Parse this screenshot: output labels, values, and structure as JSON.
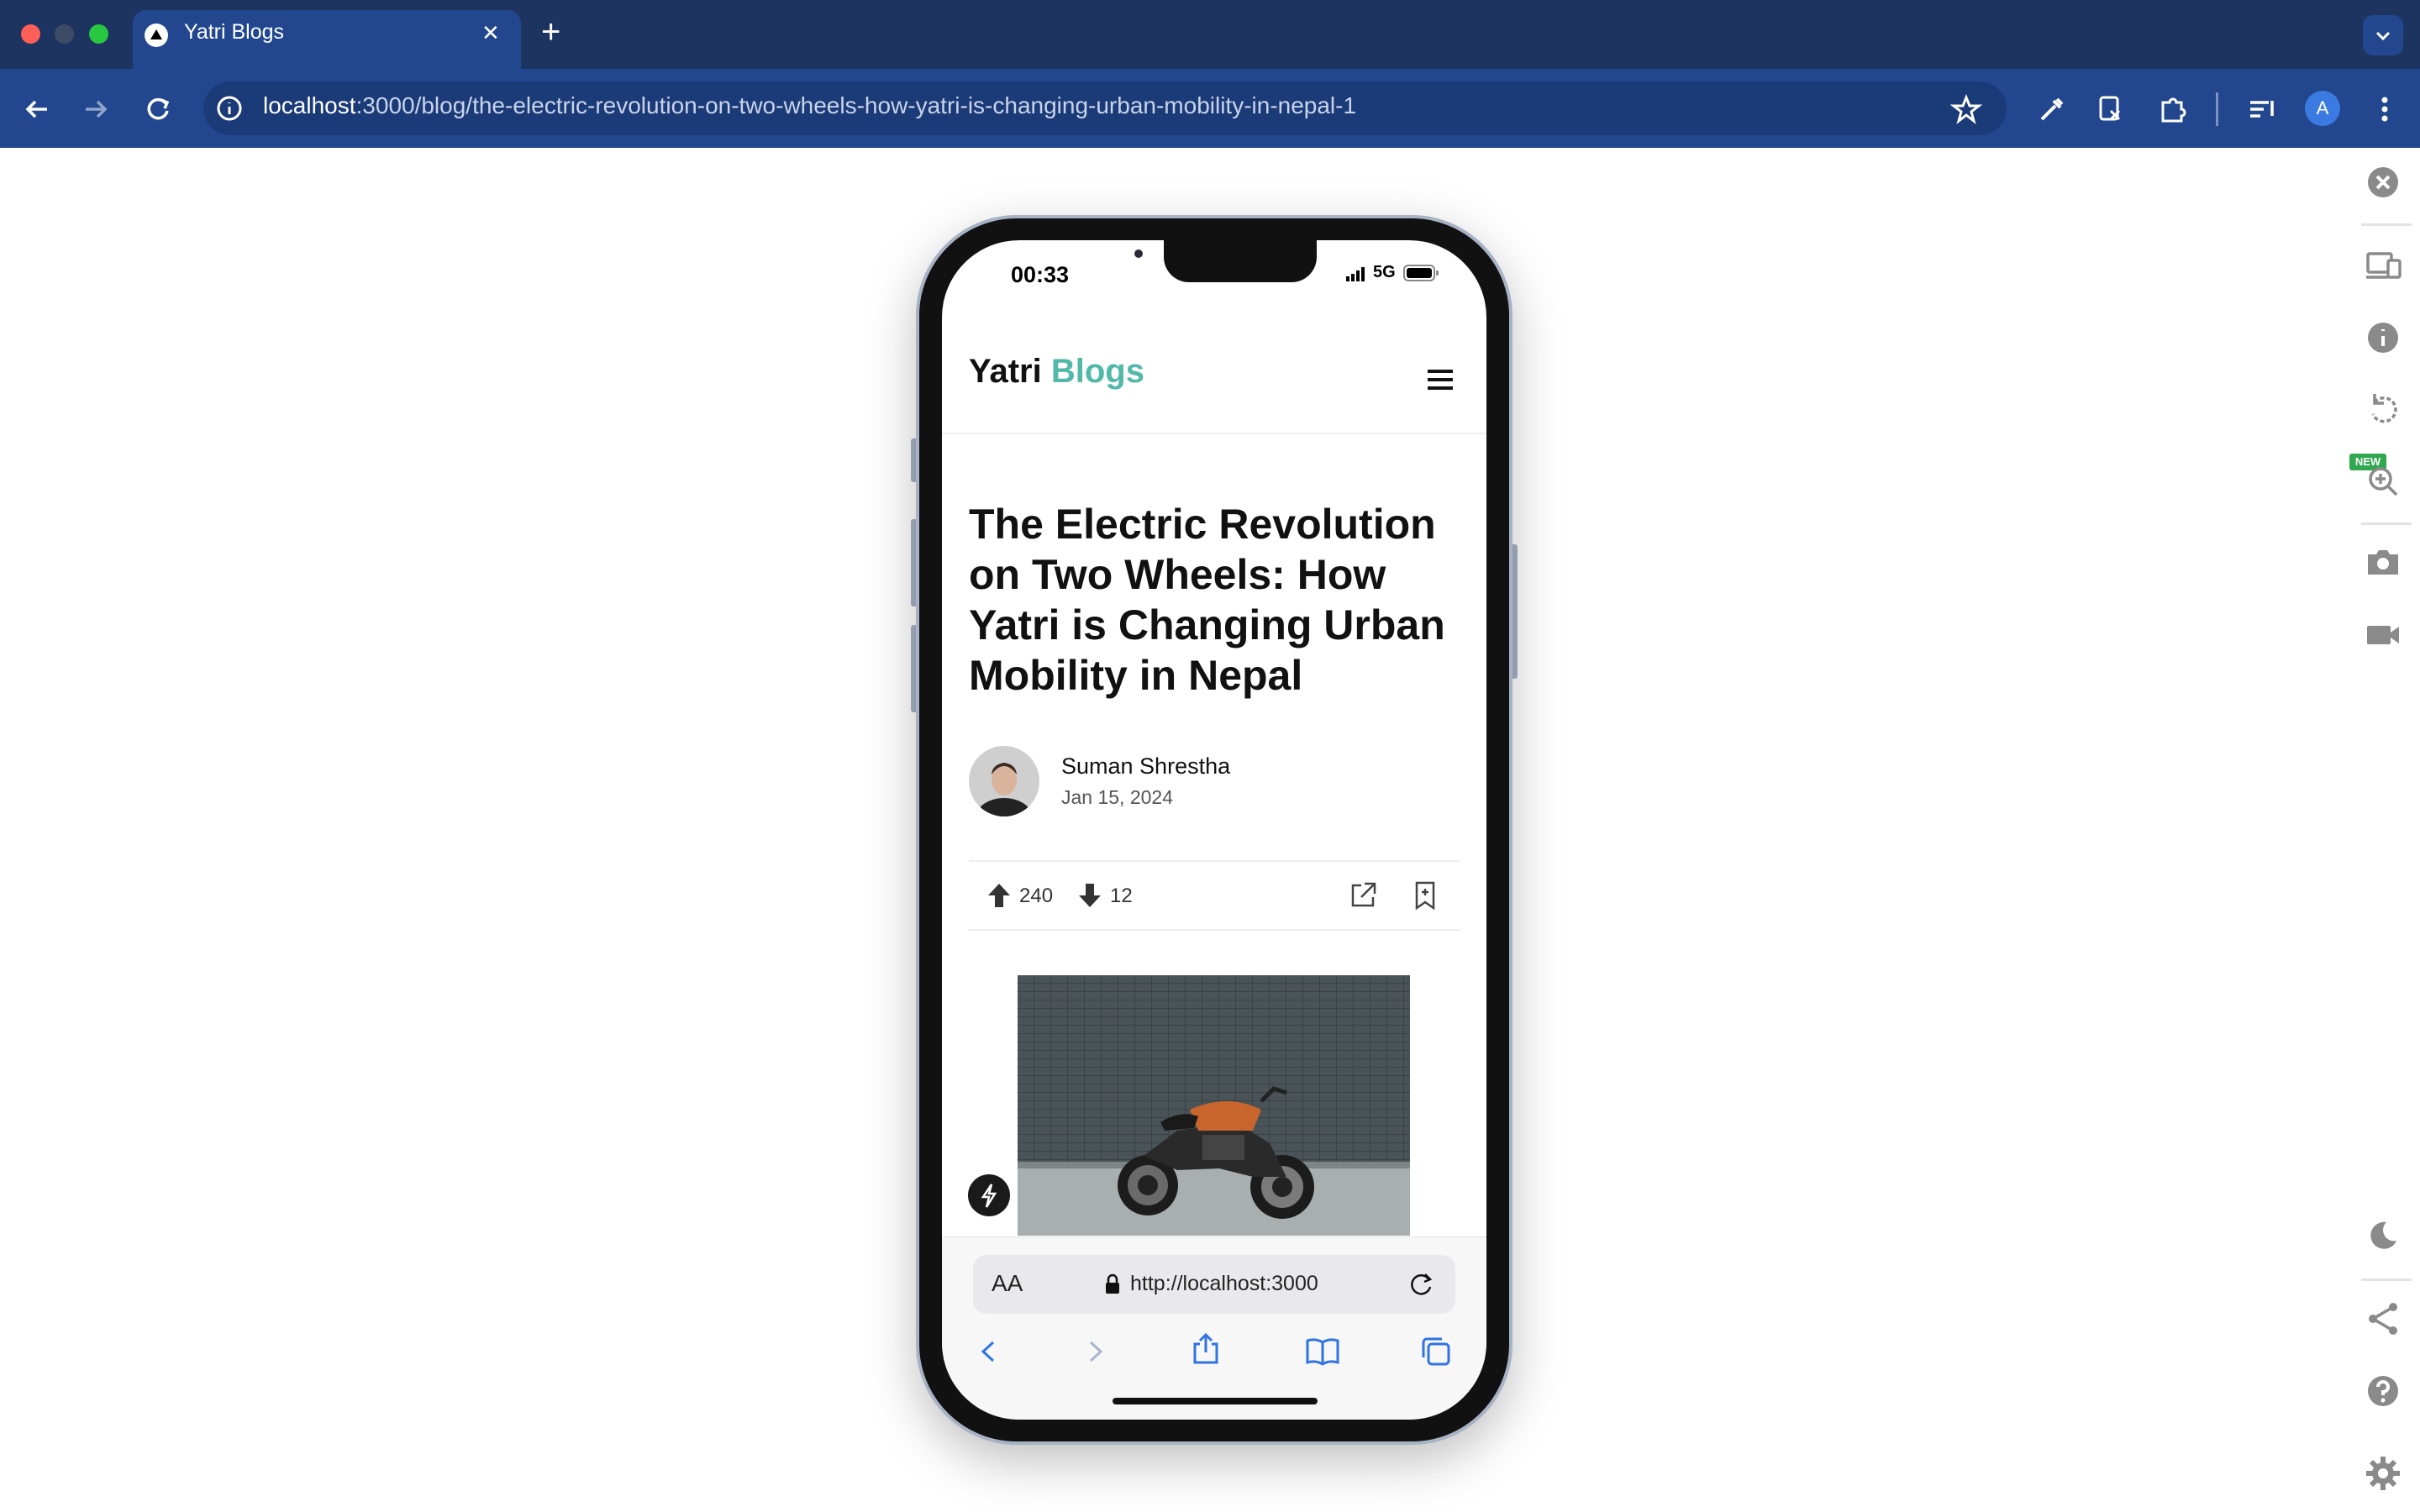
{
  "browser": {
    "tab_title": "Yatri Blogs",
    "tab_close": "✕",
    "new_tab": "+",
    "url_host": "localhost",
    "url_path": ":3000/blog/the-electric-revolution-on-two-wheels-how-yatri-is-changing-urban-mobility-in-nepal-1",
    "profile_initial": "A",
    "new_badge": "NEW"
  },
  "phone": {
    "time": "00:33",
    "network": "5G"
  },
  "site": {
    "brand_first": "Yatri",
    "brand_second": "Blogs",
    "brand_accent_color": "#52b8a8"
  },
  "article": {
    "title": "The Electric Revolution on Two Wheels: How Yatri is Changing Urban Mobility in Nepal",
    "author": "Suman Shrestha",
    "date": "Jan 15, 2024",
    "upvotes": "240",
    "downvotes": "12"
  },
  "safari": {
    "text_size_label": "AA",
    "address": "http://localhost:3000"
  }
}
